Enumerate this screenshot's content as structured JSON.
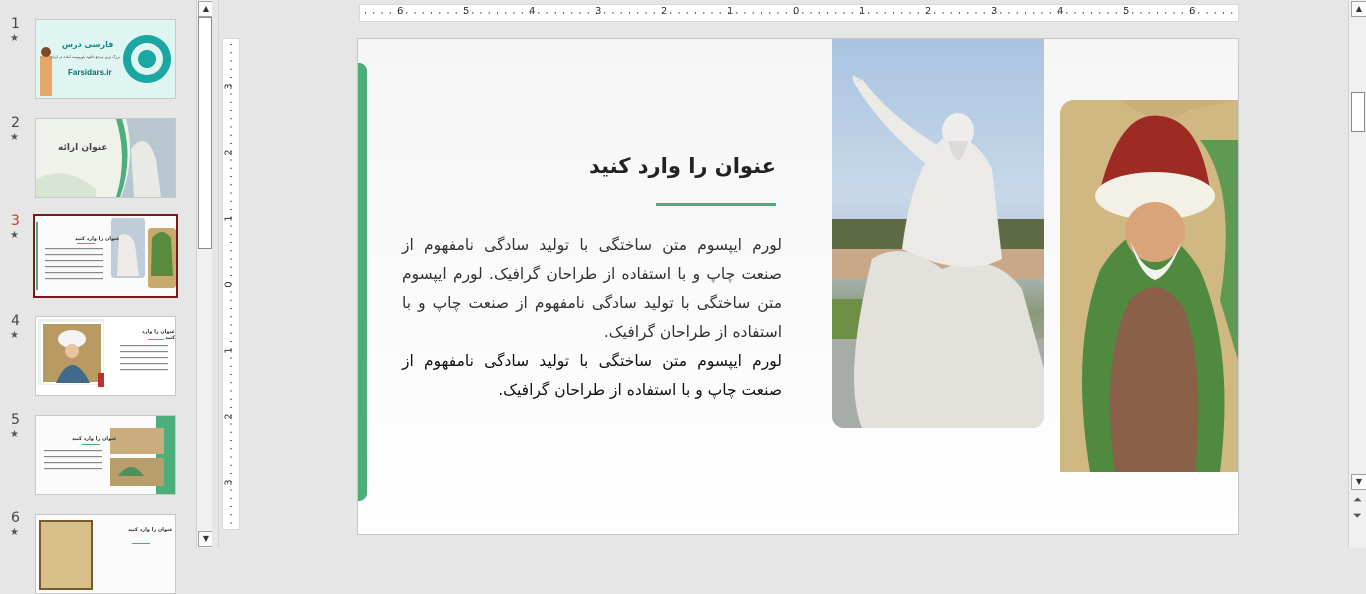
{
  "thumbnails": [
    {
      "number": "1",
      "selected": false,
      "brand_title": "فارسی درس",
      "brand_sub": "بزرگ ترین مرجع دانلود پاورپوینت آماده در ایران",
      "site": "Farsidars.ir"
    },
    {
      "number": "2",
      "selected": false,
      "title": "عنوان ارائه"
    },
    {
      "number": "3",
      "selected": true,
      "title": "عنوان را وارد کنید"
    },
    {
      "number": "4",
      "selected": false,
      "title": "عنوان را وارد کنید"
    },
    {
      "number": "5",
      "selected": false,
      "title": "عنوان را وارد کنید"
    },
    {
      "number": "6",
      "selected": false,
      "title": "عنوان را وارد کنید"
    }
  ],
  "ruler": {
    "horizontal": [
      "6",
      "5",
      "4",
      "3",
      "2",
      "1",
      "0",
      "1",
      "2",
      "3",
      "4",
      "5",
      "6"
    ],
    "vertical": [
      "3",
      "2",
      "1",
      "0",
      "1",
      "2",
      "3"
    ]
  },
  "slide": {
    "title": "عنوان را وارد کنید",
    "body_1": "لورم ایپسوم متن ساختگی با تولید سادگی نامفهوم از صنعت چاپ و با استفاده از طراحان گرافیک. لورم ایپسوم متن ساختگی با تولید سادگی نامفهوم از صنعت چاپ و با استفاده از طراحان گرافیک.",
    "body_2": "لورم ایپسوم متن ساختگی با تولید سادگی نامفهوم از صنعت چاپ و با استفاده از طراحان گرافیک."
  },
  "colors": {
    "accent": "#4cae7a",
    "selected_border": "#7a1a1a",
    "selected_number": "#c43e1c"
  },
  "icons": {
    "transition_star": "star-icon",
    "scroll_up": "arrow-up-icon",
    "scroll_down": "arrow-down-icon",
    "prev_slide": "double-up-icon",
    "next_slide": "double-down-icon"
  }
}
